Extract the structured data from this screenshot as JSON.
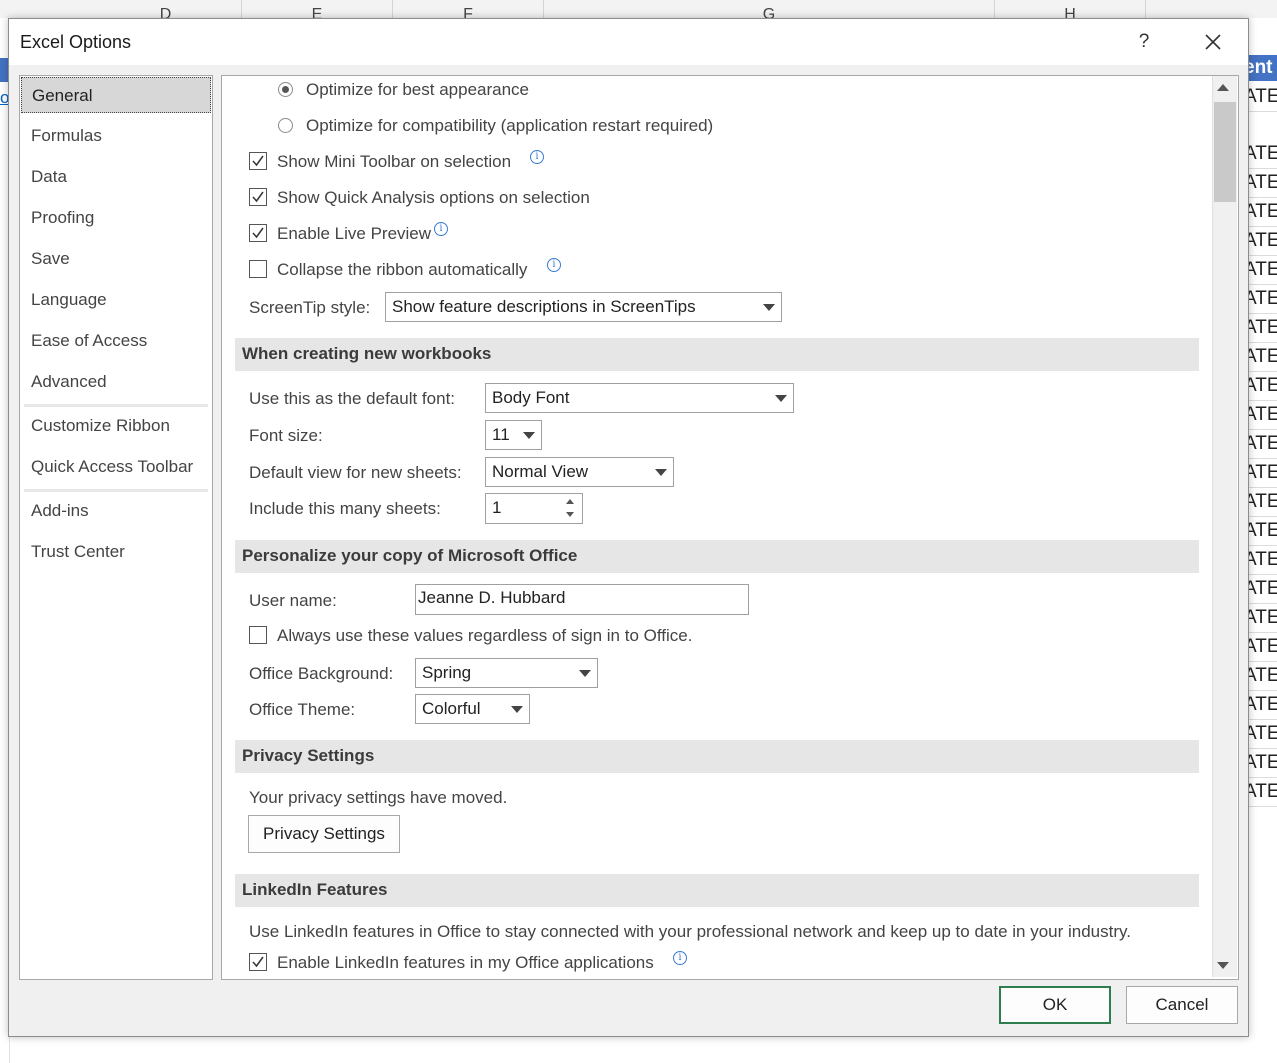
{
  "background_sheet": {
    "column_headers": [
      "D",
      "E",
      "F",
      "G",
      "H"
    ],
    "right_header_text": "ent",
    "right_cell_text": "ATE",
    "left_link_text": "o"
  },
  "dialog": {
    "title": "Excel Options",
    "help_glyph": "?",
    "close_icon": "close-icon"
  },
  "nav": {
    "items": [
      {
        "label": "General",
        "selected": true
      },
      {
        "label": "Formulas"
      },
      {
        "label": "Data"
      },
      {
        "label": "Proofing"
      },
      {
        "label": "Save"
      },
      {
        "label": "Language"
      },
      {
        "label": "Ease of Access"
      },
      {
        "label": "Advanced"
      },
      {
        "label": "Customize Ribbon"
      },
      {
        "label": "Quick Access Toolbar"
      },
      {
        "label": "Add-ins"
      },
      {
        "label": "Trust Center"
      }
    ]
  },
  "ui_options": {
    "radio_best": {
      "label": "Optimize for best appearance",
      "selected": true
    },
    "radio_compat": {
      "label": "Optimize for compatibility (application restart required)",
      "selected": false
    },
    "mini_toolbar": {
      "label": "Show Mini Toolbar on selection",
      "checked": true
    },
    "quick_analysis": {
      "label": "Show Quick Analysis options on selection",
      "checked": true
    },
    "live_preview": {
      "label": "Enable Live Preview",
      "checked": true
    },
    "collapse_ribbon": {
      "label": "Collapse the ribbon automatically",
      "checked": false
    },
    "screentip_label": "ScreenTip style:",
    "screentip_value": "Show feature descriptions in ScreenTips"
  },
  "new_workbooks": {
    "heading": "When creating new workbooks",
    "font_label": "Use this as the default font:",
    "font_value": "Body Font",
    "size_label": "Font size:",
    "size_value": "11",
    "view_label": "Default view for new sheets:",
    "view_value": "Normal View",
    "sheets_label": "Include this many sheets:",
    "sheets_value": "1"
  },
  "personalize": {
    "heading": "Personalize your copy of Microsoft Office",
    "username_label": "User name:",
    "username_value": "Jeanne D. Hubbard",
    "always_use": {
      "label": "Always use these values regardless of sign in to Office.",
      "checked": false
    },
    "background_label": "Office Background:",
    "background_value": "Spring",
    "theme_label": "Office Theme:",
    "theme_value": "Colorful"
  },
  "privacy": {
    "heading": "Privacy Settings",
    "text": "Your privacy settings have moved.",
    "button": "Privacy Settings"
  },
  "linkedin": {
    "heading": "LinkedIn Features",
    "text": "Use LinkedIn features in Office to stay connected with your professional network and keep up to date in your industry.",
    "enable": {
      "label": "Enable LinkedIn features in my Office applications",
      "checked": true
    }
  },
  "footer": {
    "ok": "OK",
    "cancel": "Cancel"
  },
  "colors": {
    "accent_blue": "#4472c4",
    "ok_border": "#2e7d4f",
    "info_icon": "#3a7bd5"
  }
}
